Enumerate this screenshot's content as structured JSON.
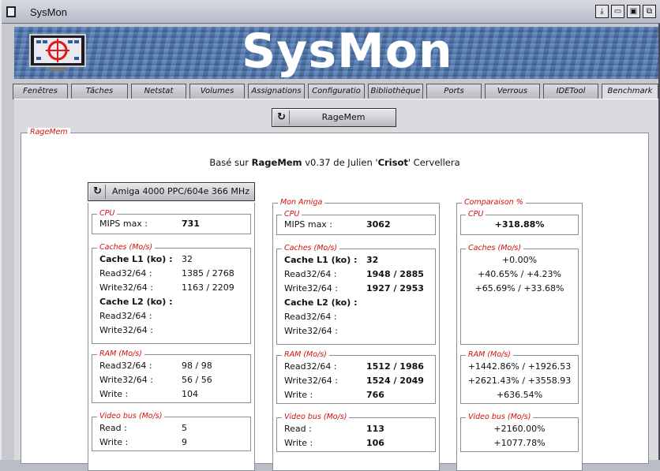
{
  "window": {
    "title": "SysMon"
  },
  "banner": {
    "logo_text": "SysMon"
  },
  "tabs": [
    "Fenêtres",
    "Tâches",
    "Netstat",
    "Volumes",
    "Assignations",
    "Configuratio",
    "Bibliothèque",
    "Ports",
    "Verrous",
    "IDETool",
    "Benchmark"
  ],
  "active_tab": "Benchmark",
  "toolbar": {
    "run_label": "RageMem"
  },
  "ragemem": {
    "legend": "RageMem",
    "credit": {
      "prefix": "Basé sur ",
      "name": "RageMem",
      "middle": " v0.37 de Julien '",
      "nick": "Crisot",
      "suffix": "' Cervellera"
    },
    "machine_select": "Amiga 4000 PPC/604e 366 MHz",
    "col2_title": "Mon Amiga",
    "col3_title": "Comparaison %",
    "groups": {
      "cpu": "CPU",
      "caches": "Caches (Mo/s)",
      "ram": "RAM (Mo/s)",
      "video": "Video bus (Mo/s)"
    },
    "labels": {
      "mips": "MIPS max :",
      "l1": "Cache L1 (ko) :",
      "read": "Read32/64 :",
      "write": "Write32/64 :",
      "l2": "Cache L2 (ko) :",
      "write_single": "Write :",
      "read_single": "Read :"
    },
    "ref": {
      "mips": "731",
      "l1": "32",
      "l1_read": "1385 / 2768",
      "l1_write": "1163 / 2209",
      "ram_read": "98 / 98",
      "ram_write": "56 / 56",
      "ram_write1": "104",
      "vid_read": "5",
      "vid_write": "9"
    },
    "mine": {
      "mips": "3062",
      "l1": "32",
      "l1_read": "1948 / 2885",
      "l1_write": "1927 / 2953",
      "ram_read": "1512 / 1986",
      "ram_write": "1524 / 2049",
      "ram_write1": "766",
      "vid_read": "113",
      "vid_write": "106"
    },
    "cmp": {
      "mips": "+318.88%",
      "l1": "+0.00%",
      "l1_read": "+40.65% / +4.23%",
      "l1_write": "+65.69% / +33.68%",
      "ram_read": "+1442.86% / +1926.53",
      "ram_write": "+2621.43% / +3558.93",
      "ram_write1": "+636.54%",
      "vid_read": "+2160.00%",
      "vid_write": "+1077.78%"
    }
  }
}
